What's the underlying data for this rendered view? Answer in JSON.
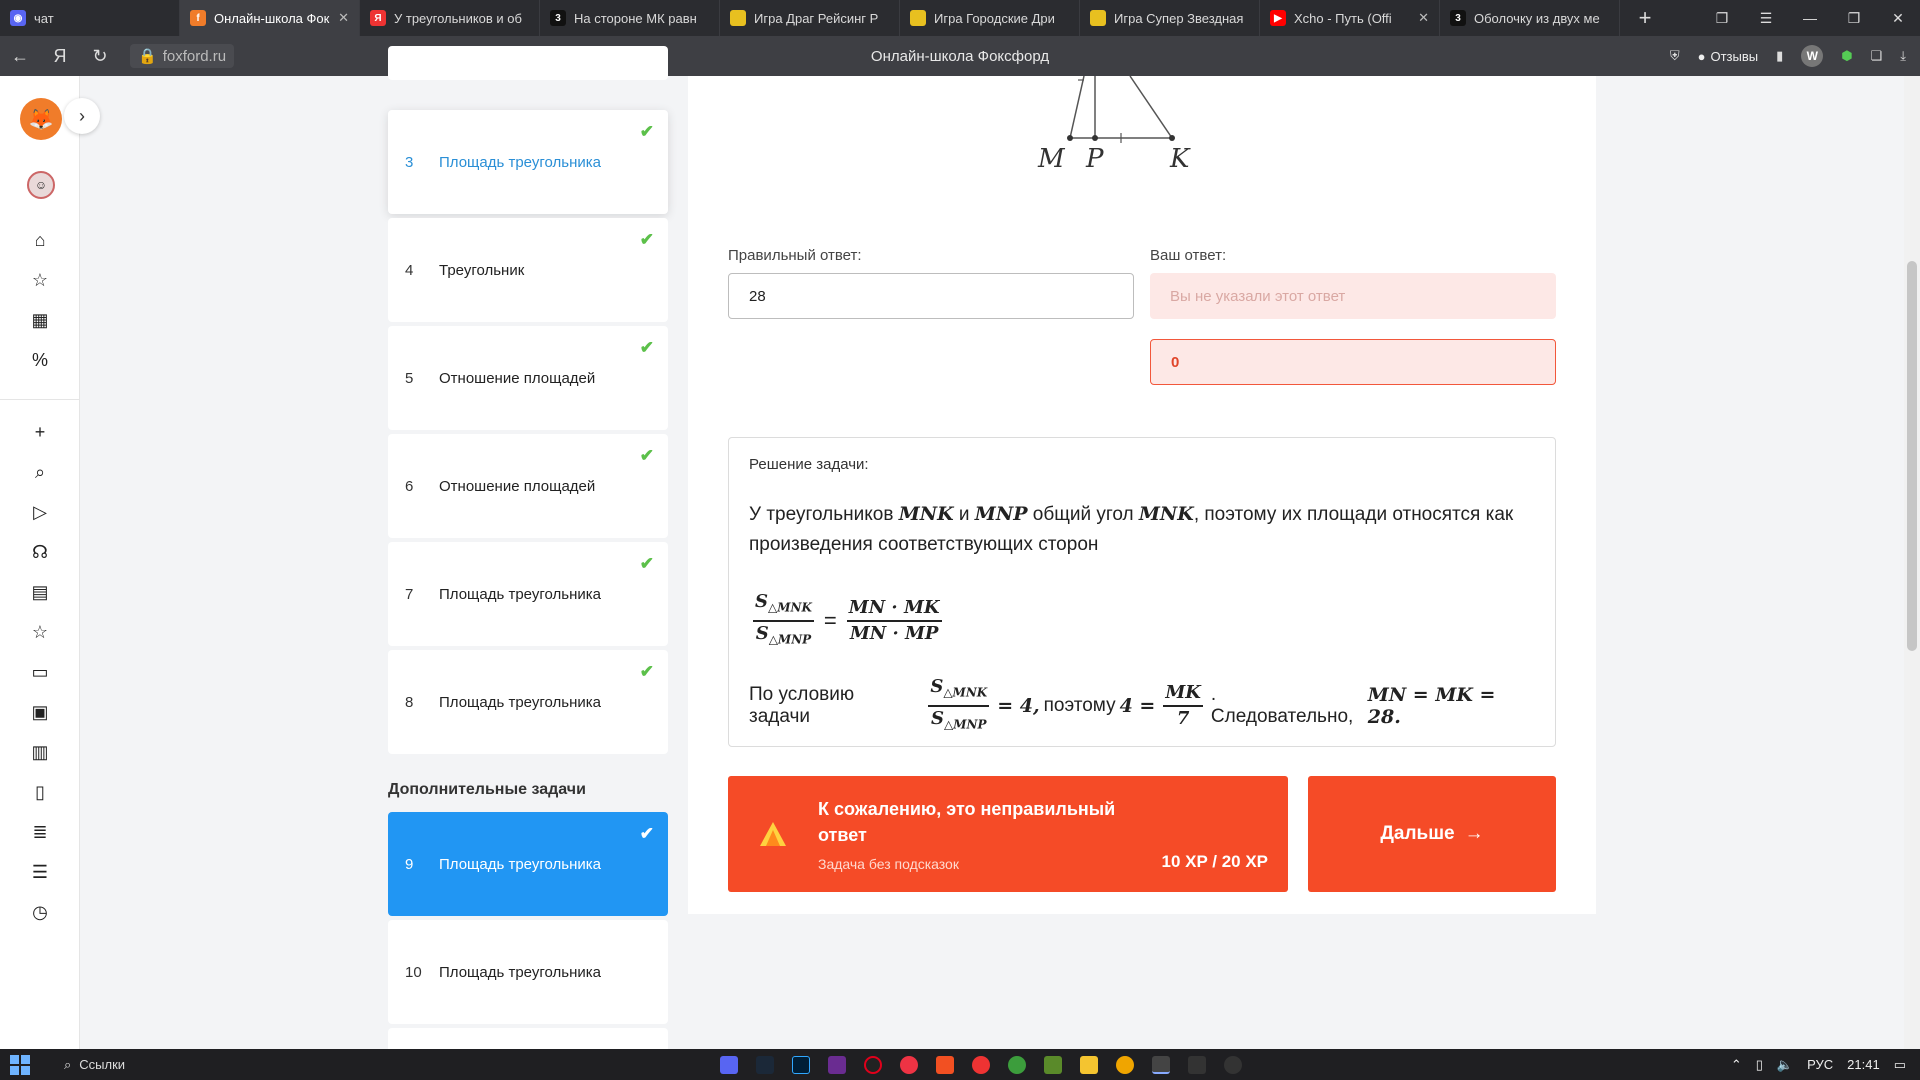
{
  "browser": {
    "tabs": [
      {
        "label": "чат",
        "color": "#5865f2",
        "active": false
      },
      {
        "label": "Онлайн-школа Фок",
        "color": "#f07c2a",
        "active": true
      },
      {
        "label": "У треугольников и об",
        "color": "#e33",
        "active": false
      },
      {
        "label": "На стороне МК равн",
        "color": "#111",
        "active": false
      },
      {
        "label": "Игра Драг Рейсинг Р",
        "color": "#e8c020",
        "active": false
      },
      {
        "label": "Игра Городские Дри",
        "color": "#e8c020",
        "active": false
      },
      {
        "label": "Игра Супер Звездная",
        "color": "#e8c020",
        "active": false
      },
      {
        "label": "Xcho - Путь (Offi",
        "color": "#f00",
        "active": false
      },
      {
        "label": "Оболочку из двух ме",
        "color": "#111",
        "active": false
      }
    ],
    "url": "foxford.ru",
    "page_title": "Онлайн-школа Фоксфорд",
    "reviews_label": "Отзывы"
  },
  "lessons": [
    {
      "num": "3",
      "title": "Площадь треугольника",
      "state": "current"
    },
    {
      "num": "4",
      "title": "Треугольник",
      "state": "done"
    },
    {
      "num": "5",
      "title": "Отношение площадей",
      "state": "done"
    },
    {
      "num": "6",
      "title": "Отношение площадей",
      "state": "done"
    },
    {
      "num": "7",
      "title": "Площадь треугольника",
      "state": "done"
    },
    {
      "num": "8",
      "title": "Площадь треугольника",
      "state": "done"
    },
    {
      "num": "9",
      "title": "Площадь треугольника",
      "state": "done-blue"
    },
    {
      "num": "10",
      "title": "Площадь треугольника",
      "state": "todo"
    }
  ],
  "extra_tasks_title": "Дополнительные задачи",
  "figure": {
    "labels": [
      "M",
      "P",
      "K"
    ]
  },
  "answers": {
    "correct_label": "Правильный ответ:",
    "correct_value": "28",
    "yours_label": "Ваш ответ:",
    "yours_placeholder": "Вы не указали этот ответ",
    "yours_value": "0"
  },
  "solution": {
    "label": "Решение задачи:",
    "text_part1": "У треугольников ",
    "mnk": "MNK",
    "and": " и ",
    "mnp": "MNP",
    "text_part2": " общий угол ",
    "angle": "MNK",
    "text_part3": ", поэтому их площади относятся как произведения соответствующих сторон",
    "formula": {
      "s_num": "S",
      "sub_num": "△MNK",
      "s_den": "S",
      "sub_den": "△MNP",
      "rhs_num": "MN · MK",
      "rhs_den": "MN · MP"
    },
    "cond_prefix": "По условию задачи",
    "cond_eq": "= 4,",
    "cond_mid": "поэтому",
    "cond_four": "4 =",
    "cond_frac_num": "MK",
    "cond_frac_den": "7",
    "cond_after": ". Следовательно,",
    "cond_result": "MN = MK = 28."
  },
  "result": {
    "title": "К сожалению, это неправильный ответ",
    "subtitle": "Задача без подсказок",
    "xp": "10 XP / 20 XP",
    "next_label": "Дальше"
  },
  "taskbar": {
    "search_label": "Ссылки",
    "lang": "РУС",
    "time": "21:41"
  },
  "colors": {
    "accent_orange": "#f54b27",
    "accent_blue": "#2196f3",
    "check_green": "#5cc04a"
  }
}
